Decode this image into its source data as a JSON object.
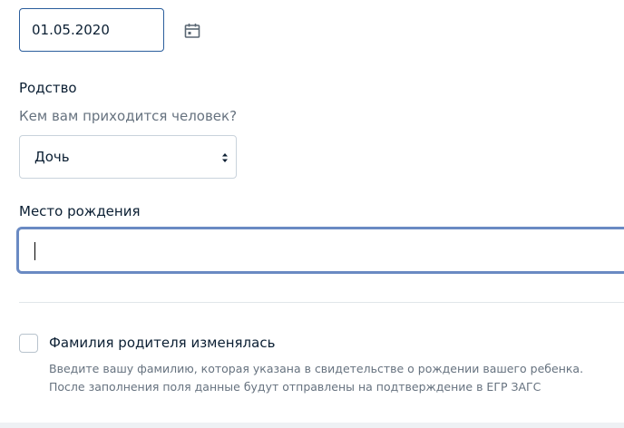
{
  "date_field": {
    "value": "01.05.2020"
  },
  "icons": {
    "calendar": "calendar-icon",
    "select_arrows": "select-arrows-icon"
  },
  "relation": {
    "label": "Родство",
    "hint": "Кем вам приходится человек?",
    "selected": "Дочь"
  },
  "birth_place": {
    "label": "Место рождения",
    "value": ""
  },
  "parent_surname": {
    "checkbox_label": "Фамилия родителя изменялась",
    "checked": false,
    "help_line1": "Введите вашу фамилию, которая указана в свидетельстве о рождении вашего ребенка.",
    "help_line2": "После заполнения поля данные будут отправлены на подтверждение в ЕГР ЗАГС"
  },
  "colors": {
    "focus_border": "#6a8ac3",
    "active_border": "#2b5e9c",
    "text": "#0b1f33",
    "muted_text": "#66727f"
  }
}
